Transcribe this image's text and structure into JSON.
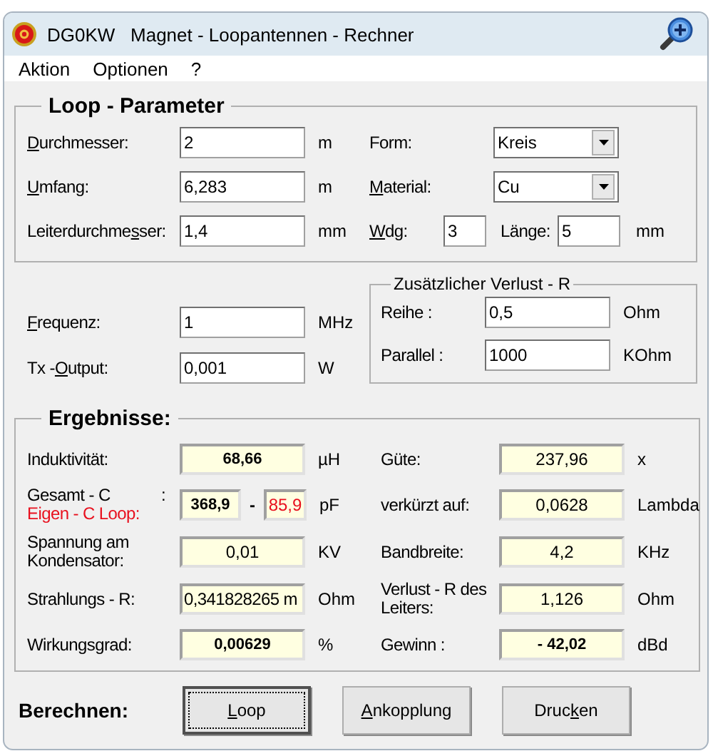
{
  "window": {
    "title": "DG0KW   Magnet - Loopantennen - Rechner"
  },
  "menu": [
    {
      "label": "Aktion"
    },
    {
      "label": "Optionen"
    },
    {
      "label": "?"
    }
  ],
  "loop_parameter": {
    "title": "Loop - Parameter",
    "left": [
      {
        "mnemonic_label": {
          "key": "D",
          "after": "urchmesser:"
        },
        "value": "2",
        "unit": "m"
      },
      {
        "mnemonic_label": {
          "key": "U",
          "after": "mfang:"
        },
        "value": "6,283",
        "unit": "m"
      },
      {
        "mnemonic_label": {
          "before": "Leiterdurchme",
          "key": "s",
          "after": "ser:"
        },
        "value": "1,4",
        "unit": "mm"
      }
    ],
    "right": [
      {
        "kind": "combo",
        "label": "Form:",
        "value": "Kreis"
      },
      {
        "kind": "combo",
        "mnemonic_label": {
          "key": "M",
          "after": "aterial:"
        },
        "value": "Cu"
      },
      {
        "kind": "turns",
        "mnemonic_label": {
          "key": "W",
          "after": "dg:"
        },
        "value": "3",
        "length_label": "Länge:",
        "length_value": "5",
        "unit": "mm"
      }
    ]
  },
  "signal": [
    {
      "mnemonic_label": {
        "key": "F",
        "after": "requenz:"
      },
      "value": "1",
      "unit": "MHz"
    },
    {
      "mnemonic_label": {
        "before": "Tx -",
        "key": "O",
        "after": "utput:"
      },
      "value": "0,001",
      "unit": "W"
    }
  ],
  "extra_loss": {
    "title": "Zusätzlicher Verlust - R",
    "rows": [
      {
        "label": "Reihe :",
        "value": "0,5",
        "unit": "Ohm"
      },
      {
        "label": "Parallel :",
        "value": "1000",
        "unit": "KOhm"
      }
    ]
  },
  "results": {
    "title": "Ergebnisse:",
    "left": [
      {
        "kind": "single",
        "label": "Induktivität:",
        "value": "68,66",
        "bold": true,
        "unit": "µH"
      },
      {
        "kind": "capacity",
        "label": "Gesamt - C",
        "colon": ":",
        "value": "368,9",
        "bold": true,
        "separator": "-",
        "sub": {
          "label": "Eigen - C  Loop:",
          "value": "85,9",
          "color": "#e8101e"
        },
        "unit": "pF"
      },
      {
        "kind": "single",
        "label": "Spannung am Kondensator:",
        "value": "0,01",
        "bold": false,
        "unit": "KV"
      },
      {
        "kind": "long",
        "label": "Strahlungs - R:",
        "value": "0,341828265 m",
        "bold": false,
        "unit": "Ohm"
      },
      {
        "kind": "single",
        "label": "Wirkungsgrad:",
        "value": "0,00629",
        "bold": true,
        "unit": "%"
      }
    ],
    "right": [
      {
        "label": "Güte:",
        "value": "237,96",
        "bold": false,
        "unit": "x"
      },
      {
        "label": "verkürzt auf:",
        "value": "0,0628",
        "bold": false,
        "unit": "Lambda"
      },
      {
        "label": "Bandbreite:",
        "value": "4,2",
        "bold": false,
        "unit": "KHz"
      },
      {
        "label": "Verlust - R des Leiters:",
        "value": "1,126",
        "bold": false,
        "unit": "Ohm"
      },
      {
        "label": "Gewinn :",
        "value": "- 42,02",
        "bold": true,
        "unit": "dBd"
      }
    ]
  },
  "calculate": {
    "label": "Berechnen:",
    "buttons": [
      {
        "mnemonic_label": {
          "key": "L",
          "after": "oop"
        },
        "focused": true
      },
      {
        "mnemonic_label": {
          "key": "A",
          "after": "nkopplung"
        },
        "focused": false
      },
      {
        "mnemonic_label": {
          "before": "Druc",
          "key": "k",
          "after": "en"
        },
        "focused": false
      }
    ]
  }
}
